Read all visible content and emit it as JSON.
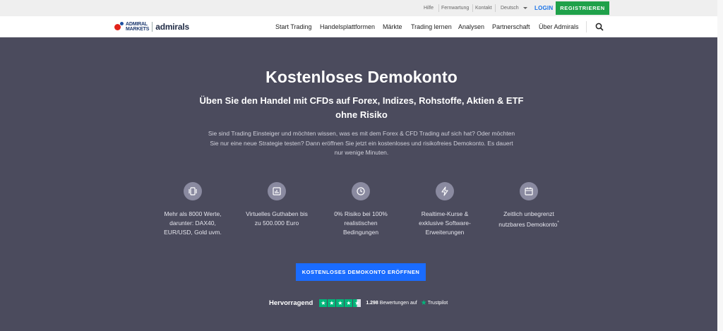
{
  "topbar": {
    "links": [
      "Hilfe",
      "Fernwartung",
      "Kontakt"
    ],
    "language": "Deutsch",
    "login": "LOGIN",
    "register": "REGISTRIEREN"
  },
  "logo": {
    "line1": "ADMIRAL",
    "line2": "MARKETS",
    "name": "admirals"
  },
  "nav": {
    "items": [
      "Start Trading",
      "Handelsplattformen",
      "Märkte",
      "Trading lernen",
      "Analysen",
      "Partnerschaft",
      "Über Admirals"
    ]
  },
  "hero": {
    "title": "Kostenloses Demokonto",
    "subtitle_line1": "Üben Sie den Handel mit CFDs auf Forex, Indizes, Rohstoffe, Aktien & ETF",
    "subtitle_line2": "ohne Risiko",
    "description_line1": "Sie sind Trading Einsteiger und möchten wissen, was es mit dem Forex & CFD Trading auf sich hat? Oder möchten",
    "description_line2": "Sie nur eine neue Strategie testen? Dann eröffnen Sie jetzt ein kostenloses und risikofreies Demokonto. Es dauert",
    "description_line3": "nur wenige Minuten."
  },
  "features": [
    {
      "icon": "instruments-icon",
      "lines": [
        "Mehr als 8000 Werte,",
        "darunter: DAX40,",
        "EUR/USD, Gold uvm."
      ]
    },
    {
      "icon": "chart-icon",
      "lines": [
        "Virtuelles Guthaben bis",
        "zu 500.000 Euro"
      ]
    },
    {
      "icon": "clock-icon",
      "lines": [
        "0% Risiko bei 100%",
        "realistischen",
        "Bedingungen"
      ]
    },
    {
      "icon": "lightning-icon",
      "lines": [
        "Realtime-Kurse &",
        "exklusive Software-",
        "Erweiterungen"
      ]
    },
    {
      "icon": "calendar-icon",
      "lines": [
        "Zeitlich unbegrenzt",
        "nutzbares Demokonto"
      ],
      "footnote": "*"
    }
  ],
  "cta": "KOSTENLOSES DEMOKONTO ERÖFFNEN",
  "trustpilot": {
    "rating_label": "Hervorragend",
    "stars": 4.5,
    "review_count": "1.298",
    "review_text": "Bewertungen auf",
    "brand": "Trustpilot"
  }
}
